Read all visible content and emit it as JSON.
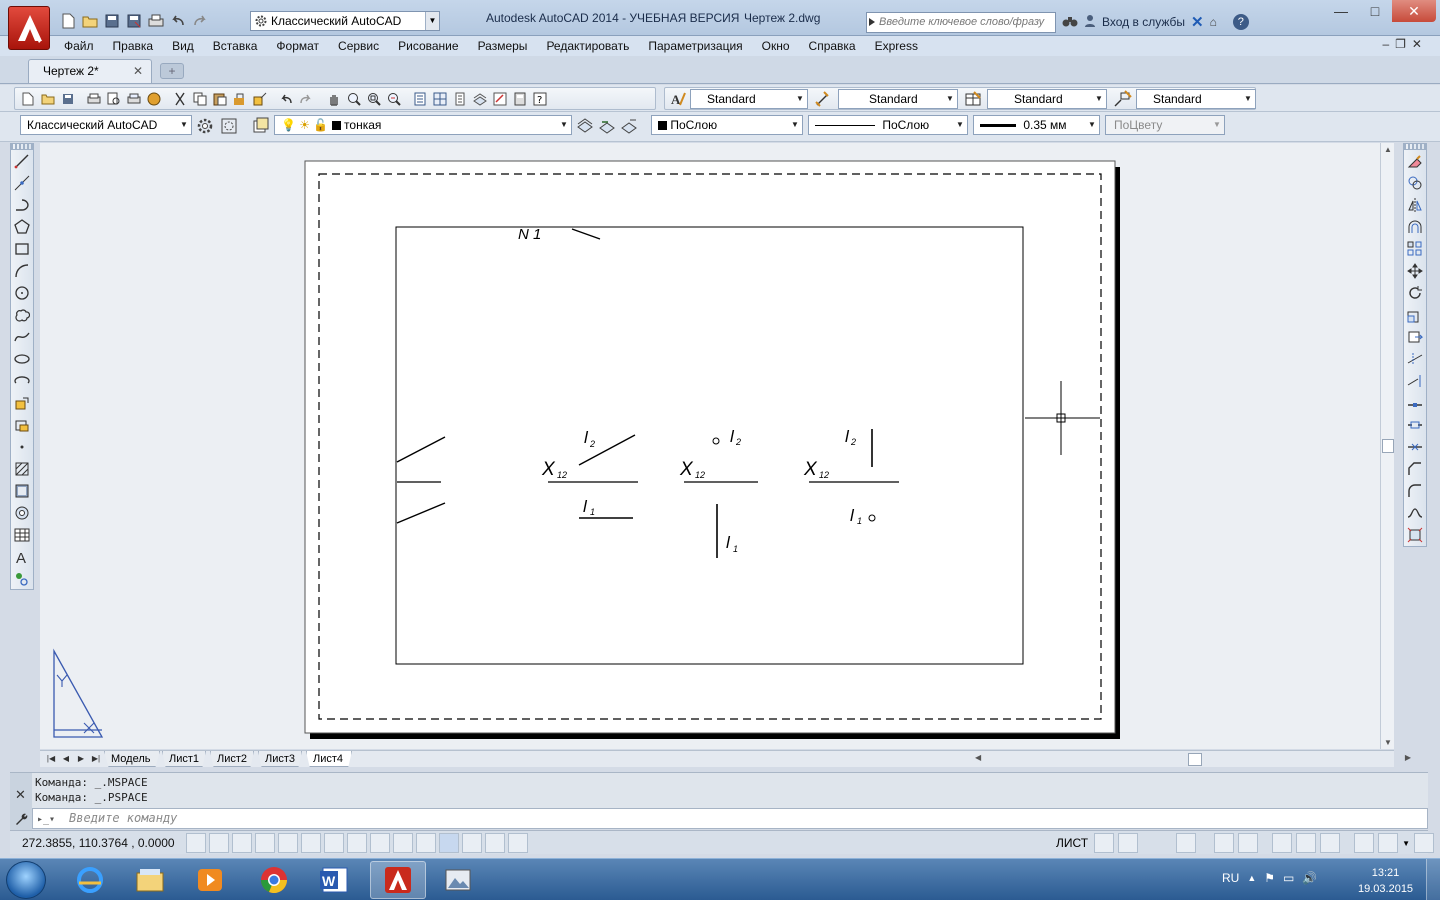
{
  "app": {
    "title": "Autodesk AutoCAD 2014 - УЧЕБНАЯ ВЕРСИЯ",
    "document": "Чертеж 2.dwg",
    "workspace": "Классический AutoCAD",
    "search_placeholder": "Введите ключевое слово/фразу",
    "signin": "Вход в службы",
    "accent": "#c5d6ea"
  },
  "menu": [
    "Файл",
    "Правка",
    "Вид",
    "Вставка",
    "Формат",
    "Сервис",
    "Рисование",
    "Размеры",
    "Редактировать",
    "Параметризация",
    "Окно",
    "Справка",
    "Express"
  ],
  "tabs": {
    "doc_tab": "Чертеж 2*",
    "close": "✕",
    "new_tab": "+"
  },
  "styles": {
    "text_style": "Standard",
    "dim_style": "Standard",
    "table_style": "Standard",
    "mleader_style": "Standard"
  },
  "properties": {
    "workspace": "Классический AutoCAD",
    "layer": "тонкая",
    "color": "ПоСлою",
    "linetype": "ПоСлою",
    "lineweight": "0.35 мм",
    "plotstyle": "ПоЦвету"
  },
  "drawing": {
    "labels": {
      "n1": "N 1",
      "x12": "X",
      "x12_sub": "12",
      "l": "l",
      "sub1": "1",
      "sub2": "2"
    }
  },
  "layouts": [
    "Модель",
    "Лист1",
    "Лист2",
    "Лист3",
    "Лист4"
  ],
  "active_layout": "Лист4",
  "command": {
    "history": [
      "Команда:  _.MSPACE",
      "Команда:  _.PSPACE"
    ],
    "placeholder": "Введите команду"
  },
  "status": {
    "coords": "272.3855, 110.3764 , 0.0000",
    "space": "ЛИСТ"
  },
  "taskbar": {
    "lang": "RU",
    "time": "13:21",
    "date": "19.03.2015"
  }
}
